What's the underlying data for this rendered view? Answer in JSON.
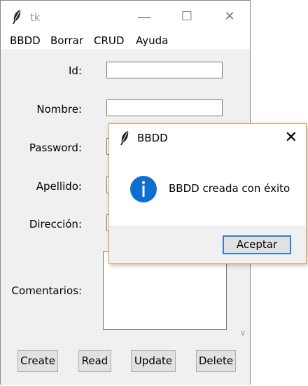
{
  "window": {
    "title": "tk",
    "minimize_glyph": "—",
    "maximize_glyph": "☐",
    "close_glyph": "✕"
  },
  "menu": {
    "items": [
      "BBDD",
      "Borrar",
      "CRUD",
      "Ayuda"
    ]
  },
  "form": {
    "labels": {
      "id": "Id:",
      "nombre": "Nombre:",
      "password": "Password:",
      "apellido": "Apellido:",
      "direccion": "Dirección:",
      "comentarios": "Comentarios:"
    },
    "values": {
      "id": "",
      "nombre": "",
      "password": "",
      "apellido": "",
      "direccion": "",
      "comentarios": ""
    }
  },
  "buttons": {
    "create": "Create",
    "read": "Read",
    "update": "Update",
    "delete": "Delete"
  },
  "dialog": {
    "title": "BBDD",
    "close_glyph": "✕",
    "message": "BBDD creada con éxito",
    "accept": "Aceptar",
    "icon": "info-icon"
  },
  "colors": {
    "dialog_border": "#e39f3c",
    "info_icon": "#0f6fd1",
    "focus_border": "#2b7fd4"
  }
}
